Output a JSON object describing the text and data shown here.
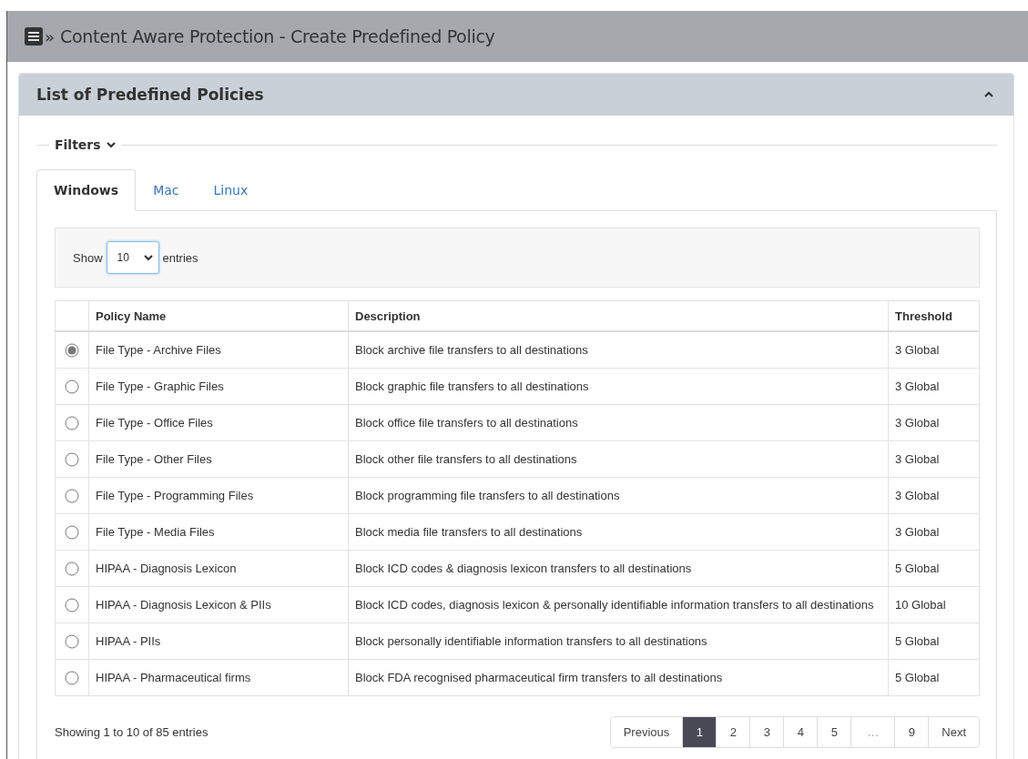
{
  "page_header": {
    "title": "Content Aware Protection - Create Predefined Policy",
    "arrow": "»"
  },
  "panel": {
    "title": "List of Predefined Policies",
    "expanded": true
  },
  "filters": {
    "label": "Filters",
    "expanded": false
  },
  "tabs": [
    {
      "label": "Windows",
      "selected": true
    },
    {
      "label": "Mac",
      "selected": false
    },
    {
      "label": "Linux",
      "selected": false
    }
  ],
  "length_control": {
    "before": "Show",
    "value": "10",
    "after": "entries"
  },
  "table": {
    "columns": [
      "Policy Name",
      "Description",
      "Threshold"
    ],
    "rows": [
      {
        "selected": true,
        "name": "File Type - Archive Files",
        "description": "Block archive file transfers to all destinations",
        "threshold": "3 Global"
      },
      {
        "selected": false,
        "name": "File Type - Graphic Files",
        "description": "Block graphic file transfers to all destinations",
        "threshold": "3 Global"
      },
      {
        "selected": false,
        "name": "File Type - Office Files",
        "description": "Block office file transfers to all destinations",
        "threshold": "3 Global"
      },
      {
        "selected": false,
        "name": "File Type - Other Files",
        "description": "Block other file transfers to all destinations",
        "threshold": "3 Global"
      },
      {
        "selected": false,
        "name": "File Type - Programming Files",
        "description": "Block programming file transfers to all destinations",
        "threshold": "3 Global"
      },
      {
        "selected": false,
        "name": "File Type - Media Files",
        "description": "Block media file transfers to all destinations",
        "threshold": "3 Global"
      },
      {
        "selected": false,
        "name": "HIPAA - Diagnosis Lexicon",
        "description": "Block ICD codes & diagnosis lexicon transfers to all destinations",
        "threshold": "5 Global"
      },
      {
        "selected": false,
        "name": "HIPAA - Diagnosis Lexicon & PIIs",
        "description": "Block ICD codes, diagnosis lexicon & personally identifiable information transfers to all destinations",
        "threshold": "10 Global"
      },
      {
        "selected": false,
        "name": "HIPAA - PIIs",
        "description": "Block personally identifiable information transfers to all destinations",
        "threshold": "5 Global"
      },
      {
        "selected": false,
        "name": "HIPAA - Pharmaceutical firms",
        "description": "Block FDA recognised pharmaceutical firm transfers to all destinations",
        "threshold": "5 Global"
      }
    ]
  },
  "info": "Showing 1 to 10 of 85 entries",
  "pagination": [
    {
      "label": "Previous",
      "selected": false,
      "kind": "nav"
    },
    {
      "label": "1",
      "selected": true,
      "kind": "page"
    },
    {
      "label": "2",
      "selected": false,
      "kind": "page"
    },
    {
      "label": "3",
      "selected": false,
      "kind": "page"
    },
    {
      "label": "4",
      "selected": false,
      "kind": "page"
    },
    {
      "label": "5",
      "selected": false,
      "kind": "page"
    },
    {
      "label": "…",
      "selected": false,
      "kind": "ellipsis"
    },
    {
      "label": "9",
      "selected": false,
      "kind": "page"
    },
    {
      "label": "Next",
      "selected": false,
      "kind": "nav"
    }
  ]
}
